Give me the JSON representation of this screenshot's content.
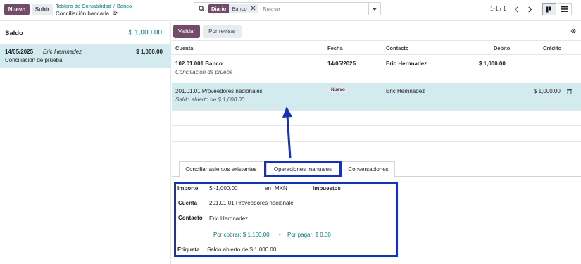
{
  "toolbar": {
    "new_label": "Nuevo",
    "upload_label": "Subir"
  },
  "breadcrumb": {
    "parent": "Tablero de Contabilidad",
    "separator": "/",
    "current": "Banco"
  },
  "page_subtitle": "Conciliación bancaria",
  "search": {
    "facet_label": "Diario",
    "facet_value": "Banco",
    "placeholder": "Buscar..."
  },
  "pager": {
    "text": "1-1 / 1"
  },
  "left_panel": {
    "saldo_label": "Saldo",
    "saldo_value": "$ 1,000.00",
    "statement": {
      "date": "14/05/2025",
      "partner": "Eric Hernnadez",
      "amount": "$ 1,000.00",
      "reference": "Conciliación de prueba"
    }
  },
  "actions": {
    "validate_label": "Validar",
    "review_label": "Por revisar"
  },
  "grid": {
    "headers": {
      "account": "Cuenta",
      "date": "Fecha",
      "contact": "Contacto",
      "debit": "Débito",
      "credit": "Crédito"
    },
    "rows": [
      {
        "account": "102.01.001 Banco",
        "note": "Conciliación de prueba",
        "date": "14/05/2025",
        "contact": "Eric Hernnadez",
        "debit": "$ 1,000.00",
        "credit": ""
      },
      {
        "account": "201.01.01 Proveedores nacionales",
        "note": "Saldo abierto de $ 1,000.00",
        "badge": "Nuevo",
        "contact": "Eric Hernnadez",
        "debit": "",
        "credit": "$ 1,000.00"
      }
    ]
  },
  "tabs": [
    {
      "label": "Conciliar asientos existentes"
    },
    {
      "label": "Operaciones manuales"
    },
    {
      "label": "Conversaciones"
    }
  ],
  "manual_form": {
    "importe_label": "Importe",
    "importe_value": "$ -1,000.00",
    "currency_prefix": "en",
    "currency": "MXN",
    "taxes_label": "Impuestos",
    "account_label": "Cuenta",
    "account_value": "201.01.01 Proveedores nacionale",
    "contact_label": "Contacto",
    "contact_value": "Eric Hernnadez",
    "receivable_text": "Por cobrar: $ 1,160.00",
    "dash": "-",
    "payable_text": "Por pagar: $ 0.00",
    "label_label": "Etiqueta",
    "label_value": "Saldo abierto de $ 1,000.00"
  },
  "colors": {
    "brand": "#714B67",
    "accent": "#017e84",
    "highlight": "#d3ebee",
    "annotation": "#1532b8"
  },
  "icons": [
    "search-icon",
    "gear-icon",
    "close-icon",
    "chevron-down-icon",
    "chevron-left-icon",
    "chevron-right-icon",
    "kanban-view-icon",
    "list-view-icon",
    "trash-icon",
    "settings-icon"
  ]
}
